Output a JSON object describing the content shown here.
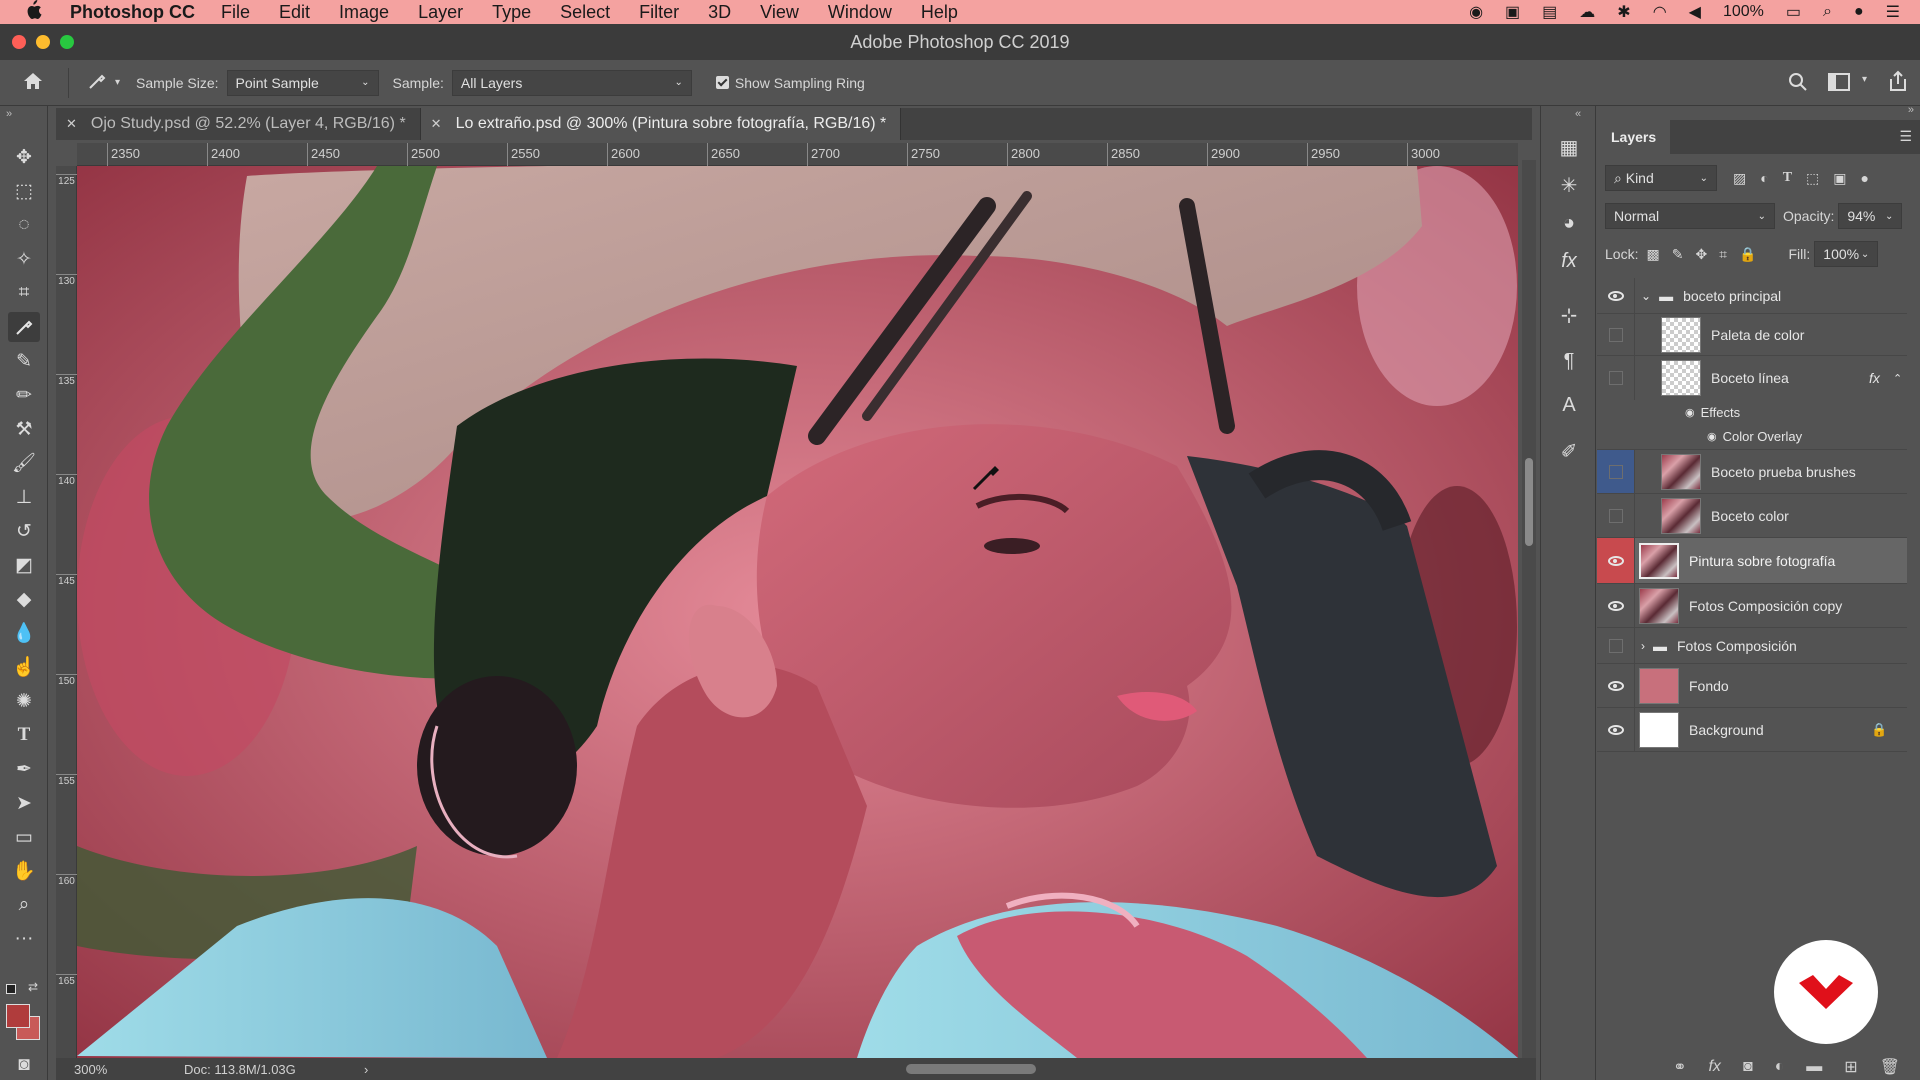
{
  "menubar": {
    "app_name": "Photoshop CC",
    "items": [
      "File",
      "Edit",
      "Image",
      "Layer",
      "Type",
      "Select",
      "Filter",
      "3D",
      "View",
      "Window",
      "Help"
    ],
    "battery": "100%"
  },
  "window": {
    "title": "Adobe Photoshop CC 2019"
  },
  "options": {
    "sample_size_label": "Sample Size:",
    "sample_size_value": "Point Sample",
    "sample_label": "Sample:",
    "sample_value": "All Layers",
    "show_ring_label": "Show Sampling Ring"
  },
  "tabs": [
    {
      "label": "Ojo Study.psd @ 52.2% (Layer 4, RGB/16) *",
      "active": false
    },
    {
      "label": "Lo extraño.psd @ 300% (Pintura sobre fotografía, RGB/16) *",
      "active": true
    }
  ],
  "ruler": {
    "h_marks": [
      "2350",
      "2400",
      "2450",
      "2500",
      "2550",
      "2600",
      "2650",
      "2700",
      "2750",
      "2800",
      "2850",
      "2900",
      "2950",
      "3000"
    ],
    "v_marks": [
      "125",
      "130",
      "135",
      "140",
      "145",
      "150",
      "155",
      "160",
      "165"
    ]
  },
  "status": {
    "zoom": "300%",
    "doc": "Doc: 113.8M/1.03G"
  },
  "layers_panel": {
    "title": "Layers",
    "filter_kind": "Kind",
    "blend_mode": "Normal",
    "opacity_label": "Opacity:",
    "opacity_value": "94%",
    "lock_label": "Lock:",
    "fill_label": "Fill:",
    "fill_value": "100%",
    "effects_label": "Effects",
    "color_overlay_label": "Color Overlay",
    "layers": [
      {
        "name": "boceto principal",
        "visible": true,
        "group": true
      },
      {
        "name": "Paleta de color",
        "visible": false
      },
      {
        "name": "Boceto línea",
        "visible": false,
        "fx": true
      },
      {
        "name": "Boceto prueba brushes",
        "visible": false,
        "highlight": "blue"
      },
      {
        "name": "Boceto color",
        "visible": false
      },
      {
        "name": "Pintura sobre fotografía",
        "visible": true,
        "selected": true
      },
      {
        "name": "Fotos Composición copy",
        "visible": true
      },
      {
        "name": "Fotos Composición",
        "visible": false,
        "group": true
      },
      {
        "name": "Fondo",
        "visible": true
      },
      {
        "name": "Background",
        "visible": true,
        "locked": true
      }
    ]
  },
  "colors": {
    "menubar": "#f4a2a0",
    "selected_layer_eye": "#c84a4e",
    "badge_logo": "#e0101a"
  }
}
